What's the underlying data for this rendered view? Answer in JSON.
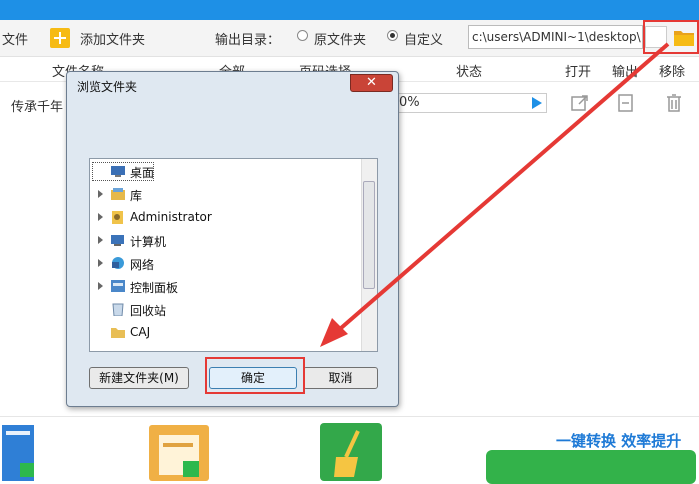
{
  "toolbar": {
    "file_label": "文件",
    "add_folder_label": "添加文件夹",
    "output_dir_label": "输出目录：",
    "option_source": "原文件夹",
    "option_custom": "自定义",
    "path_value": "c:\\users\\ADMINI~1\\desktop\\"
  },
  "table": {
    "headers": [
      "文件名称",
      "全部",
      "页码选择",
      "状态",
      "打开",
      "输出",
      "移除"
    ],
    "row": {
      "name": "传承千年",
      "progress_text": "0%"
    }
  },
  "dialog": {
    "title": "浏览文件夹",
    "close": "✕",
    "tree": [
      {
        "label": "桌面",
        "icon": "desktop-icon",
        "expandable": false
      },
      {
        "label": "库",
        "icon": "library-icon",
        "expandable": true
      },
      {
        "label": "Administrator",
        "icon": "user-icon",
        "expandable": true
      },
      {
        "label": "计算机",
        "icon": "computer-icon",
        "expandable": true
      },
      {
        "label": "网络",
        "icon": "network-icon",
        "expandable": true
      },
      {
        "label": "控制面板",
        "icon": "control-panel-icon",
        "expandable": true
      },
      {
        "label": "回收站",
        "icon": "recycle-bin-icon",
        "expandable": false
      },
      {
        "label": "CAJ",
        "icon": "folder-icon",
        "expandable": false
      }
    ],
    "new_folder": "新建文件夹(M)",
    "ok": "确定",
    "cancel": "取消"
  },
  "bottom": {
    "brand": "一键转换  效率提升"
  },
  "colors": {
    "accent_blue": "#1e90e6",
    "highlight_red": "#e53935",
    "folder_yellow": "#f6bb14",
    "convert_green": "#33b24a"
  }
}
